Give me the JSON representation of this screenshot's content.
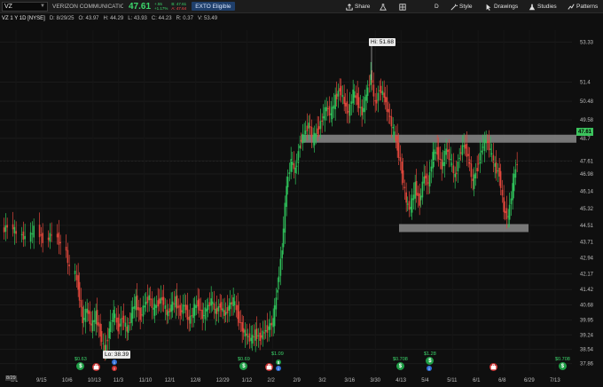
{
  "toolbar": {
    "symbol": "VZ",
    "company": "VERIZON COMMUNICATIO",
    "last": "47.61",
    "change": "+.55",
    "change_pct": "+1.17%",
    "bid": "B: 47.61",
    "ask": "A: 47.64",
    "exto": "EXTO Eligible",
    "share": "Share",
    "aggregation": "D",
    "style": "Style",
    "drawings": "Drawings",
    "studies": "Studies",
    "patterns": "Patterns"
  },
  "chart_header": {
    "title": "VZ 1 Y 1D [NYSE]",
    "date": "D: 8/29/25",
    "open": "O: 43.97",
    "high": "H: 44.29",
    "low": "L: 43.93",
    "close": "C: 44.23",
    "range": "R: 0.37",
    "volume": "V: 53.49"
  },
  "annotations": {
    "hi": "Hi: 51.68",
    "lo": "Lo: 38.39",
    "price_tag": "47.61",
    "date_tag": "8/29"
  },
  "dividends": [
    "$0.63",
    "$0.69",
    "$1.09",
    "$0.708",
    "$1.28",
    "$0.708"
  ],
  "chart_data": {
    "type": "candlestick",
    "y_ticks": [
      "53.33",
      "51.4",
      "50.48",
      "49.58",
      "48.7",
      "47.61",
      "46.98",
      "46.14",
      "45.32",
      "44.51",
      "43.71",
      "42.94",
      "42.17",
      "41.42",
      "40.68",
      "39.95",
      "39.24",
      "38.54",
      "37.86"
    ],
    "x_ticks": [
      "9/1",
      "9/15",
      "10/6",
      "10/13",
      "11/3",
      "11/10",
      "12/1",
      "12/8",
      "12/29",
      "1/12",
      "2/2",
      "2/9",
      "3/2",
      "3/16",
      "3/30",
      "4/13",
      "5/4",
      "5/11",
      "6/1",
      "6/8",
      "6/29",
      "7/13"
    ],
    "ylim": [
      37.5,
      53.9
    ],
    "levels": [
      {
        "kind": "resistance",
        "value": 48.7
      },
      {
        "kind": "support",
        "value": 44.4
      }
    ],
    "series": [
      {
        "points": [
          [
            0,
            44.23
          ],
          [
            10,
            44.5
          ],
          [
            20,
            44.1
          ],
          [
            30,
            43.9
          ],
          [
            40,
            44.3
          ],
          [
            50,
            43.8
          ],
          [
            60,
            44.1
          ],
          [
            70,
            43.6
          ],
          [
            80,
            42.4
          ],
          [
            85,
            41.6
          ],
          [
            90,
            39.9
          ],
          [
            95,
            40.5
          ],
          [
            100,
            39.6
          ],
          [
            105,
            40.2
          ],
          [
            110,
            39.3
          ],
          [
            115,
            38.39
          ],
          [
            120,
            39.5
          ],
          [
            125,
            40.3
          ],
          [
            130,
            39.6
          ],
          [
            135,
            40.1
          ],
          [
            140,
            39.4
          ],
          [
            145,
            40.2
          ],
          [
            150,
            40.9
          ],
          [
            155,
            40.1
          ],
          [
            160,
            40.7
          ],
          [
            165,
            41.1
          ],
          [
            170,
            40.4
          ],
          [
            175,
            40.8
          ],
          [
            180,
            41.0
          ],
          [
            185,
            40.2
          ],
          [
            190,
            40.6
          ],
          [
            195,
            40.9
          ],
          [
            200,
            40.3
          ],
          [
            205,
            40.7
          ],
          [
            210,
            39.9
          ],
          [
            215,
            40.4
          ],
          [
            220,
            40.8
          ],
          [
            225,
            40.1
          ],
          [
            230,
            40.5
          ],
          [
            235,
            40.9
          ],
          [
            240,
            40.3
          ],
          [
            245,
            40.7
          ],
          [
            250,
            40.2
          ],
          [
            255,
            40.6
          ],
          [
            260,
            40.9
          ],
          [
            265,
            40.2
          ],
          [
            270,
            39.5
          ],
          [
            275,
            39.2
          ],
          [
            280,
            39.0
          ],
          [
            285,
            39.3
          ],
          [
            290,
            39.1
          ],
          [
            295,
            39.4
          ],
          [
            300,
            39.6
          ],
          [
            305,
            39.9
          ],
          [
            310,
            41.6
          ],
          [
            315,
            43.4
          ],
          [
            320,
            46.4
          ],
          [
            325,
            47.6
          ],
          [
            330,
            47.1
          ],
          [
            335,
            48.5
          ],
          [
            340,
            48.9
          ],
          [
            345,
            49.4
          ],
          [
            350,
            48.6
          ],
          [
            355,
            49.1
          ],
          [
            360,
            49.6
          ],
          [
            365,
            50.2
          ],
          [
            370,
            49.8
          ],
          [
            375,
            50.6
          ],
          [
            380,
            51.1
          ],
          [
            385,
            50.4
          ],
          [
            390,
            49.9
          ],
          [
            395,
            50.9
          ],
          [
            400,
            50.5
          ],
          [
            405,
            49.9
          ],
          [
            410,
            50.8
          ],
          [
            415,
            51.68
          ],
          [
            420,
            50.3
          ],
          [
            425,
            51.1
          ],
          [
            430,
            50.7
          ],
          [
            435,
            49.9
          ],
          [
            440,
            49.1
          ],
          [
            445,
            48.3
          ],
          [
            450,
            47.1
          ],
          [
            455,
            45.6
          ],
          [
            460,
            45.3
          ],
          [
            465,
            46.4
          ],
          [
            470,
            45.6
          ],
          [
            475,
            46.9
          ],
          [
            480,
            46.5
          ],
          [
            485,
            47.9
          ],
          [
            490,
            48.1
          ],
          [
            495,
            47.3
          ],
          [
            500,
            48.2
          ],
          [
            505,
            47.6
          ],
          [
            510,
            46.8
          ],
          [
            515,
            47.9
          ],
          [
            520,
            48.4
          ],
          [
            525,
            47.8
          ],
          [
            530,
            46.5
          ],
          [
            535,
            47.3
          ],
          [
            540,
            48.2
          ],
          [
            545,
            48.6
          ],
          [
            550,
            48.1
          ],
          [
            555,
            47.3
          ],
          [
            560,
            47.0
          ],
          [
            565,
            45.2
          ],
          [
            570,
            44.9
          ],
          [
            575,
            46.4
          ],
          [
            580,
            47.61
          ]
        ]
      }
    ]
  }
}
